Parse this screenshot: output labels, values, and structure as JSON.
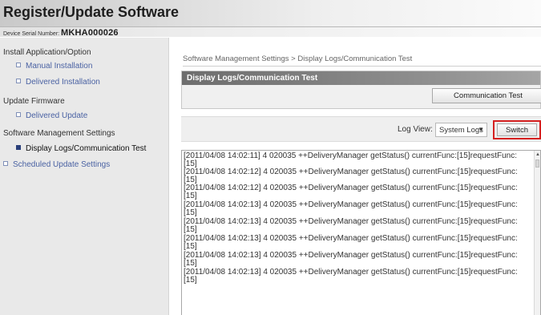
{
  "header": {
    "title": "Register/Update Software"
  },
  "serial": {
    "label": "Device Serial Number:",
    "value": "MKHA000026"
  },
  "sidebar": {
    "items": [
      {
        "label": "Install Application/Option",
        "kind": "heading"
      },
      {
        "label": "Manual Installation",
        "kind": "link"
      },
      {
        "label": "Delivered Installation",
        "kind": "link"
      },
      {
        "label": "Update Firmware",
        "kind": "heading"
      },
      {
        "label": "Delivered Update",
        "kind": "link"
      },
      {
        "label": "Software Management Settings",
        "kind": "heading"
      },
      {
        "label": "Display Logs/Communication Test",
        "kind": "active"
      },
      {
        "label": "Scheduled Update Settings",
        "kind": "link"
      }
    ]
  },
  "main": {
    "breadcrumb": "Software Management Settings > Display Logs/Communication Test",
    "panel_title": "Display Logs/Communication Test",
    "comm_test_button": "Communication Test",
    "log_view_label": "Log View:",
    "log_view_selected": "System Logs",
    "switch_button": "Switch",
    "log_lines": [
      "[2011/04/08 14:02:11] 4 020035 ++DeliveryManager getStatus() currentFunc:[15]requestFunc:",
      "[15]",
      "[2011/04/08 14:02:12] 4 020035 ++DeliveryManager getStatus() currentFunc:[15]requestFunc:",
      "[15]",
      "[2011/04/08 14:02:12] 4 020035 ++DeliveryManager getStatus() currentFunc:[15]requestFunc:",
      "[15]",
      "[2011/04/08 14:02:13] 4 020035 ++DeliveryManager getStatus() currentFunc:[15]requestFunc:",
      "[15]",
      "[2011/04/08 14:02:13] 4 020035 ++DeliveryManager getStatus() currentFunc:[15]requestFunc:",
      "[15]",
      "[2011/04/08 14:02:13] 4 020035 ++DeliveryManager getStatus() currentFunc:[15]requestFunc:",
      "[15]",
      "[2011/04/08 14:02:13] 4 020035 ++DeliveryManager getStatus() currentFunc:[15]requestFunc:",
      "[15]",
      "[2011/04/08 14:02:13] 4 020035 ++DeliveryManager getStatus() currentFunc:[15]requestFunc:",
      "[15]"
    ]
  },
  "icons": {
    "bullet": "square-bullet-icon",
    "bullet_active": "filled-square-bullet-icon",
    "dropdown": "chevron-down-icon",
    "scroll_up": "scroll-up-arrow-icon"
  },
  "colors": {
    "link": "#4a62a3",
    "panel_title_bg": "#6d6d6d",
    "switch_highlight": "#d52020"
  }
}
